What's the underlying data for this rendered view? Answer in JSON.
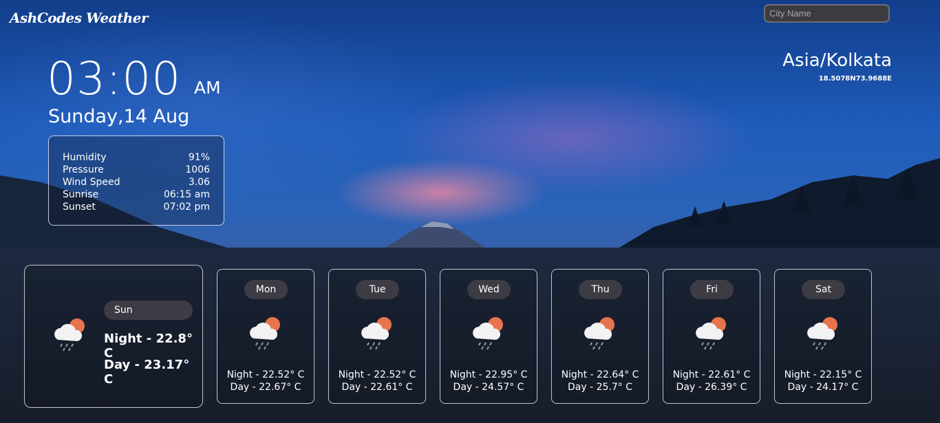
{
  "app": {
    "logo": "AshCodes Weather"
  },
  "search": {
    "placeholder": "City Name"
  },
  "clock": {
    "time": "03:00",
    "ampm": "AM",
    "date": "Sunday,14 Aug"
  },
  "details": [
    {
      "label": "Humidity",
      "value": "91%"
    },
    {
      "label": "Pressure",
      "value": "1006"
    },
    {
      "label": "Wind Speed",
      "value": "3.06"
    },
    {
      "label": "Sunrise",
      "value": "06:15 am"
    },
    {
      "label": "Sunset",
      "value": "07:02 pm"
    }
  ],
  "location": {
    "timezone": "Asia/Kolkata",
    "coords": "18.5078N73.9688E"
  },
  "today": {
    "day": "Sun",
    "night": "Night - 22.8° C",
    "day_temp": "Day - 23.17° C",
    "icon": "cloud-sun-rain-icon"
  },
  "forecast": [
    {
      "day": "Mon",
      "night": "Night - 22.52° C",
      "day_temp": "Day - 22.67° C",
      "icon": "cloud-sun-rain-icon"
    },
    {
      "day": "Tue",
      "night": "Night - 22.52° C",
      "day_temp": "Day - 22.61° C",
      "icon": "cloud-sun-rain-icon"
    },
    {
      "day": "Wed",
      "night": "Night - 22.95° C",
      "day_temp": "Day - 24.57° C",
      "icon": "cloud-sun-rain-icon"
    },
    {
      "day": "Thu",
      "night": "Night - 22.64° C",
      "day_temp": "Day - 25.7° C",
      "icon": "cloud-sun-rain-icon"
    },
    {
      "day": "Fri",
      "night": "Night - 22.61° C",
      "day_temp": "Day - 26.39° C",
      "icon": "cloud-sun-rain-icon"
    },
    {
      "day": "Sat",
      "night": "Night - 22.15° C",
      "day_temp": "Day - 24.17° C",
      "icon": "cloud-sun-rain-icon"
    }
  ],
  "colors": {
    "sky": "#1e5cbb",
    "panel": "#16191f",
    "pill": "#3d3c44",
    "sun": "#e8734d"
  }
}
